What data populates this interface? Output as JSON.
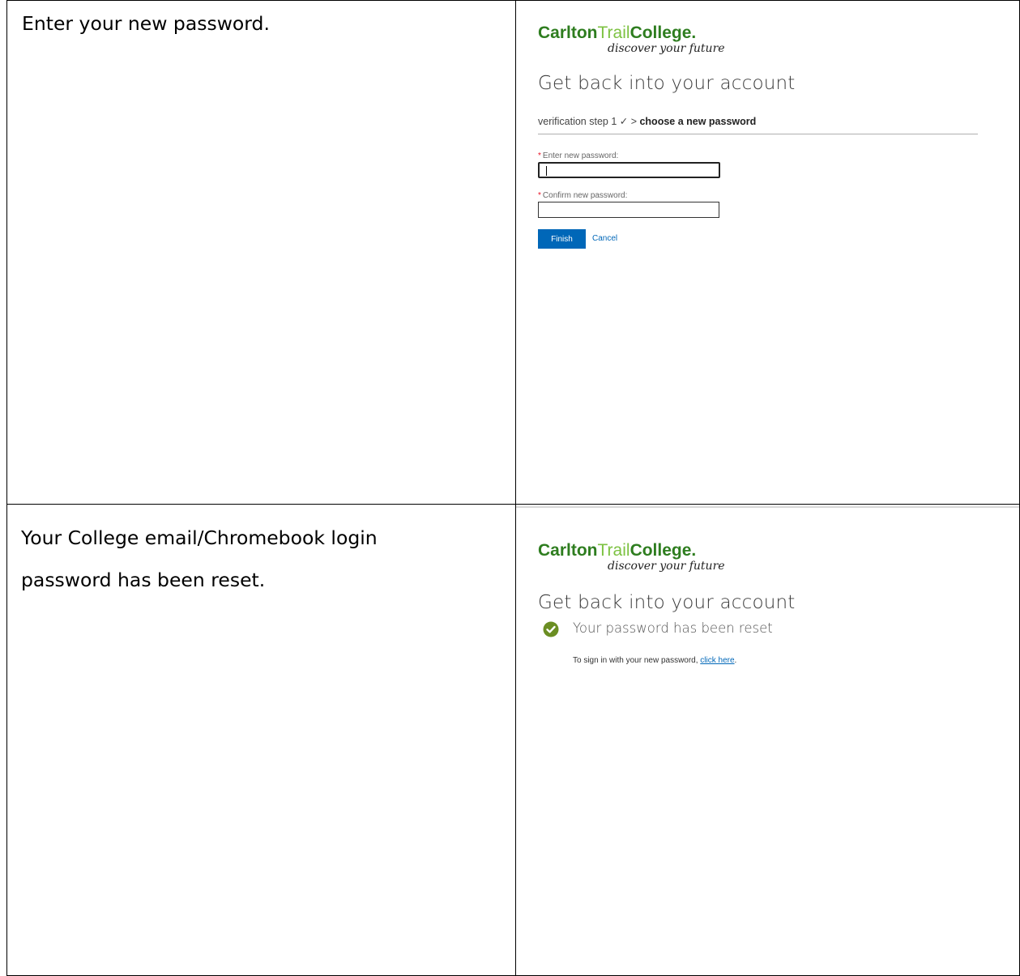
{
  "rows": [
    {
      "instruction": "Enter your new password.",
      "screen": {
        "logo": {
          "name_part1": "Carlton",
          "name_part2": "Trail",
          "name_part3": "College.",
          "tagline": "discover your future"
        },
        "heading": "Get back into your account",
        "steps": {
          "done": "verification step 1 ✓ > ",
          "current": "choose a new password"
        },
        "fields": [
          {
            "required_mark": "*",
            "label": "Enter new password:",
            "value": ""
          },
          {
            "required_mark": "*",
            "label": "Confirm new password:",
            "value": ""
          }
        ],
        "finish_label": "Finish",
        "cancel_label": "Cancel"
      }
    },
    {
      "instruction_lines": [
        "Your College email/Chromebook login",
        "password has been reset."
      ],
      "screen": {
        "logo": {
          "name_part1": "Carlton",
          "name_part2": "Trail",
          "name_part3": "College.",
          "tagline": "discover your future"
        },
        "heading": "Get back into your account",
        "success_message": "Your password has been reset",
        "signin_prefix": "To sign in with your new password, ",
        "signin_link": "click here",
        "signin_suffix": "."
      }
    }
  ],
  "colors": {
    "logo_dark_green": "#2e7d1f",
    "logo_light_green": "#7dc242",
    "button_blue": "#0067b8",
    "link_blue": "#0067b8",
    "success_green": "#6b8e23",
    "required_red": "#e81123"
  },
  "icons": {
    "success": "check-circle-icon"
  }
}
